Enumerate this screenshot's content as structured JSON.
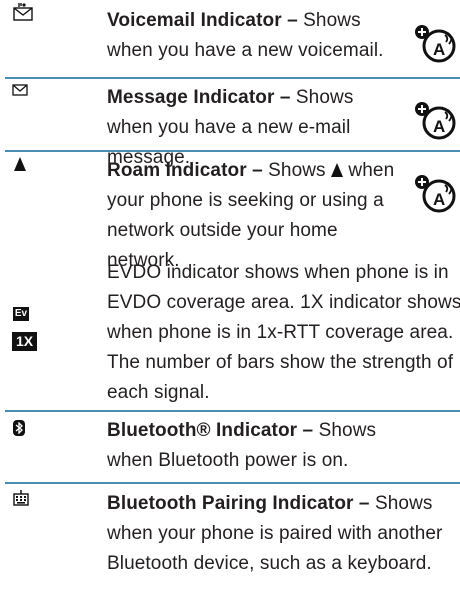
{
  "rows": [
    {
      "icon": "voicemail-icon",
      "title": "Voicemail Indicator –",
      "desc": " Shows when you have a new voicemail.",
      "badge": "speakerphone-accessibility-icon"
    },
    {
      "icon": "message-envelope-icon",
      "title": "Message Indicator –",
      "desc": " Shows when you have a new e-mail message.",
      "badge": "speakerphone-accessibility-icon"
    },
    {
      "icon": "roam-triangle-icon",
      "title": "Roam Indicator –",
      "desc_before": " Shows ",
      "desc_after": " when your phone is seeking or using a network outside your home network.",
      "badge": "speakerphone-accessibility-icon"
    },
    {
      "icon_ev_label": "Ev",
      "icon_1x_label": "1X",
      "desc": "EVDO indicator shows when phone is in EVDO coverage area. 1X indicator shows when phone is in 1x-RTT coverage area. The number of bars show the strength of each signal."
    },
    {
      "icon": "bluetooth-icon",
      "title": "Bluetooth® Indicator –",
      "desc": " Shows when Bluetooth power is on."
    },
    {
      "icon": "bluetooth-keyboard-icon",
      "title": "Bluetooth Pairing Indicator –",
      "desc": " Shows when your phone is paired with another Bluetooth device, such as a keyboard."
    }
  ],
  "colors": {
    "rule": "#4a8fb3",
    "text": "#231f20"
  }
}
